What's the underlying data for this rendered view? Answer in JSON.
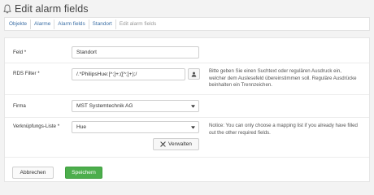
{
  "page": {
    "title": "Edit alarm fields"
  },
  "breadcrumb": {
    "items": [
      "Objekte",
      "Alarme",
      "Alarm fields",
      "Standort"
    ],
    "current": "Edit alarm fields"
  },
  "form": {
    "feld": {
      "label": "Feld *",
      "value": "Standort"
    },
    "rds_filter": {
      "label": "RDS Filter *",
      "value": "/.*PhilipsHue:[^;]+;([^;]+);/",
      "help_line1": "Bitte geben Sie einen Suchtext oder regulären Ausdruck ein,",
      "help_line2": "welcher dem Auslesefeld übereinstimmen soll. Reguläre Ausdrücke",
      "help_line3": "beinhalten ein Trennzeichen."
    },
    "firma": {
      "label": "Firma",
      "selected": "MST Systemtechnik AG"
    },
    "verknuepfungs_liste": {
      "label": "Verknüpfungs-Liste *",
      "selected": "Hue",
      "help_line1": "Notice: You can only choose a mapping list if you already have filled",
      "help_line2": "out the other required fields.",
      "manage_label": "Verwalten"
    }
  },
  "actions": {
    "cancel_label": "Abbrechen",
    "save_label": "Speichern"
  },
  "icons": {
    "title": "bell-icon",
    "rds_button": "user-icon",
    "manage_button": "wrench-icon",
    "select_caret": "caret-down-icon"
  },
  "colors": {
    "link": "#3a6ea5",
    "save_button": "#4cae4c",
    "background": "#f3f3f3"
  }
}
